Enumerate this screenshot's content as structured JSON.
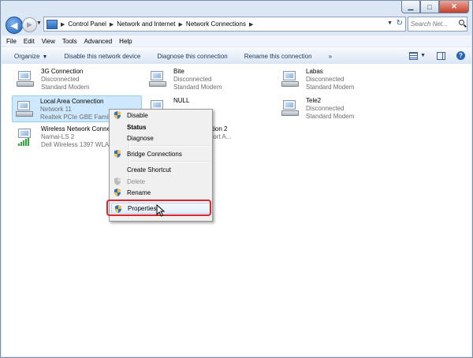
{
  "address": {
    "crumbs": [
      "Control Panel",
      "Network and Internet",
      "Network Connections"
    ],
    "search_placeholder": "Search Net..."
  },
  "menubar": {
    "file": "File",
    "edit": "Edit",
    "view": "View",
    "tools": "Tools",
    "advanced": "Advanced",
    "help": "Help"
  },
  "commandbar": {
    "organize": "Organize",
    "disable": "Disable this network device",
    "diagnose": "Diagnose this connection",
    "rename": "Rename this connection",
    "more": "»"
  },
  "connections": [
    {
      "name": "3G Connection",
      "status": "Disconnected",
      "device": "Standard Modem",
      "icon": "modem-icon"
    },
    {
      "name": "Bite",
      "status": "Disconnected",
      "device": "Standard Modem",
      "icon": "modem-icon"
    },
    {
      "name": "Labas",
      "status": "Disconnected",
      "device": "Standard Modem",
      "icon": "modem-icon"
    },
    {
      "name": "Local Area Connection",
      "status": "Network 11",
      "device": "Realtek PCIe GBE Family",
      "icon": "network-adapter-icon"
    },
    {
      "name": "NULL",
      "status": "",
      "device": "",
      "icon": "modem-icon"
    },
    {
      "name": "Tele2",
      "status": "Disconnected",
      "device": "Standard Modem",
      "icon": "modem-icon"
    },
    {
      "name": "Wireless Network Conne",
      "status": "Namai-LS 2",
      "device": "Dell Wireless 1397 WLAN",
      "icon": "wifi-adapter-icon"
    },
    {
      "name": "twork Connection 2",
      "status": "",
      "device": "ual WiFi Miniport A...",
      "icon": "wifi-adapter-icon"
    }
  ],
  "context_menu": {
    "disable": "Disable",
    "status": "Status",
    "diagnose": "Diagnose",
    "bridge": "Bridge Connections",
    "shortcut": "Create Shortcut",
    "delete": "Delete",
    "rename": "Rename",
    "properties": "Properties"
  },
  "colors": {
    "highlight_box": "#d8262b",
    "selection": "#cde8ff"
  }
}
